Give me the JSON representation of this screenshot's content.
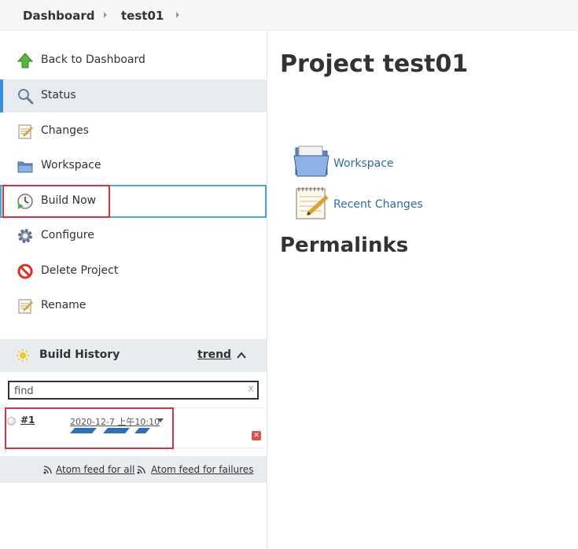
{
  "breadcrumb": {
    "items": [
      "Dashboard",
      "test01"
    ]
  },
  "sidebar": {
    "tasks": [
      {
        "label": "Back to Dashboard",
        "icon": "up-arrow-icon"
      },
      {
        "label": "Status",
        "icon": "search-icon"
      },
      {
        "label": "Changes",
        "icon": "notepad-icon"
      },
      {
        "label": "Workspace",
        "icon": "folder-icon"
      },
      {
        "label": "Build Now",
        "icon": "clock-icon"
      },
      {
        "label": "Configure",
        "icon": "gear-icon"
      },
      {
        "label": "Delete Project",
        "icon": "no-entry-icon"
      },
      {
        "label": "Rename",
        "icon": "notepad-icon"
      }
    ]
  },
  "build_history": {
    "title": "Build History",
    "trend_label": "trend",
    "search_placeholder": "find",
    "clear_label": "x",
    "builds": [
      {
        "number": "#1",
        "date": "2020-12-7 上午10:10"
      }
    ],
    "feeds": {
      "all": "Atom feed for all",
      "failures": "Atom feed for failures"
    }
  },
  "main": {
    "title": "Project test01",
    "links": [
      {
        "label": "Workspace",
        "icon": "folder-icon"
      },
      {
        "label": "Recent Changes",
        "icon": "notepad-icon"
      }
    ],
    "permalinks_title": "Permalinks"
  },
  "colors": {
    "accent": "#3a8fd6",
    "highlight_box": "#d8343f",
    "link": "#2e6ca4",
    "progress": "#2d6fb8"
  }
}
